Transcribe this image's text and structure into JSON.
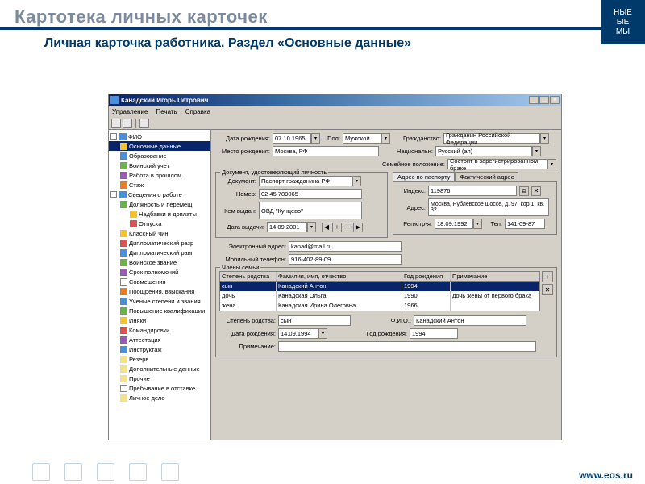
{
  "slide": {
    "title": "Картотека личных карточек",
    "subtitle": "Личная карточка работника. Раздел «Основные данные»",
    "footer_url": "www.eos.ru",
    "logo_lines": [
      "НЫЕ",
      "ЫЕ",
      "МЫ"
    ]
  },
  "window": {
    "title": "Канадский Игорь Петрович",
    "menus": [
      "Управление",
      "Печать",
      "Справка"
    ],
    "close": "✕",
    "min": "_",
    "max": "□"
  },
  "tree": [
    {
      "t": "ФИО",
      "lv": 0,
      "exp": "−",
      "ic": "ic-b"
    },
    {
      "t": "Основные данные",
      "lv": 1,
      "sel": true,
      "ic": "ic-y"
    },
    {
      "t": "Образование",
      "lv": 1,
      "ic": "ic-b"
    },
    {
      "t": "Воинский учет",
      "lv": 1,
      "ic": "ic-g"
    },
    {
      "t": "Работа в прошлом",
      "lv": 1,
      "ic": "ic-p"
    },
    {
      "t": "Стаж",
      "lv": 1,
      "ic": "ic-o"
    },
    {
      "t": "Сведения о работе",
      "lv": 0,
      "exp": "−",
      "ic": "ic-b"
    },
    {
      "t": "Должность и перемещ",
      "lv": 1,
      "ic": "ic-g"
    },
    {
      "t": "Надбавки и доплаты",
      "lv": 2,
      "ic": "ic-y"
    },
    {
      "t": "Отпуска",
      "lv": 2,
      "ic": "ic-r"
    },
    {
      "t": "Классный чин",
      "lv": 1,
      "ic": "ic-y"
    },
    {
      "t": "Дипломатический разр",
      "lv": 1,
      "ic": "ic-r"
    },
    {
      "t": "Дипломатический ранг",
      "lv": 1,
      "ic": "ic-b"
    },
    {
      "t": "Воинское звание",
      "lv": 1,
      "ic": "ic-g"
    },
    {
      "t": "Срок полномочий",
      "lv": 1,
      "ic": "ic-p"
    },
    {
      "t": "Совмещения",
      "lv": 1,
      "ic": "ic-w"
    },
    {
      "t": "Поощрения, взыскания",
      "lv": 1,
      "ic": "ic-o"
    },
    {
      "t": "Ученые степени и звания",
      "lv": 1,
      "ic": "ic-b"
    },
    {
      "t": "Повышение квалификации",
      "lv": 1,
      "ic": "ic-g"
    },
    {
      "t": "Иняки",
      "lv": 1,
      "ic": "ic-y"
    },
    {
      "t": "Командировки",
      "lv": 1,
      "ic": "ic-r"
    },
    {
      "t": "Аттестация",
      "lv": 1,
      "ic": "ic-p"
    },
    {
      "t": "Инструктаж",
      "lv": 1,
      "ic": "ic-b"
    },
    {
      "t": "Резерв",
      "lv": 1,
      "ic": "ic-folder"
    },
    {
      "t": "Дополнительные данные",
      "lv": 1,
      "ic": "ic-folder"
    },
    {
      "t": "Прочие",
      "lv": 1,
      "ic": "ic-folder"
    },
    {
      "t": "Пребывание в отставке",
      "lv": 1,
      "ic": "ic-w"
    },
    {
      "t": "Личное дело",
      "lv": 1,
      "ic": "ic-folder"
    }
  ],
  "form": {
    "birth_label": "Дата рождения:",
    "birth_value": "07.10.1965",
    "sex_label": "Пол:",
    "sex_value": "Мужской",
    "citizenship_label": "Гражданство:",
    "citizenship_value": "Гражданин Российской Федерации",
    "birthplace_label": "Место рождения:",
    "birthplace_value": "Москва, РФ",
    "nationality_label": "Национальн:",
    "nationality_value": "Русский (ая)",
    "marital_label": "Семейное положение:",
    "marital_value": "Состоит в зарегистрированном браке",
    "doc_group": "Документ, удостоверяющий личность",
    "addr_group_tabs": [
      "Адрес по паспорту",
      "Фактический адрес"
    ],
    "doc_label": "Документ:",
    "doc_value": "Паспорт гражданина РФ",
    "number_label": "Номер:",
    "number_value": "02 45 789065",
    "issuer_label": "Кем выдан:",
    "issuer_value": "ОВД \"Кунцево\"",
    "issue_date_label": "Дата выдачи:",
    "issue_date_value": "14.09.2001",
    "index_label": "Индекс:",
    "index_value": "119876",
    "address_label": "Адрес:",
    "address_value": "Москва, Рублевское шоссе, д. 97, кор 1, кв. 32",
    "reg_label": "Регистр-я:",
    "reg_value": "18.09.1992",
    "tel_label": "Тел:",
    "tel_value": "141-09-87",
    "email_label": "Электронный адрес:",
    "email_value": "kanad@mail.ru",
    "mobile_label": "Мобильный телефон:",
    "mobile_value": "916-402-89-09",
    "family_group": "Члены семьи",
    "fam_headers": [
      "Степень родства",
      "Фамилия, имя, отчество",
      "Год рождения",
      "Примечание"
    ],
    "fam_rows": [
      {
        "rel": "сын",
        "name": "Канадский Антон",
        "year": "1994",
        "note": ""
      },
      {
        "rel": "дочь",
        "name": "Канадская Ольга",
        "year": "1990",
        "note": "дочь жены от первого брака"
      },
      {
        "rel": "жена",
        "name": "Канадская Ирина Олеговна",
        "year": "1966",
        "note": ""
      }
    ],
    "det_rel_label": "Степень родства:",
    "det_rel_value": "сын",
    "det_fio_label": "Ф.И.О.:",
    "det_fio_value": "Канадский Антон",
    "det_birth_label": "Дата рождения:",
    "det_birth_value": "14.09.1994",
    "det_year_label": "Год рождения:",
    "det_year_value": "1994",
    "det_note_label": "Примечание:",
    "det_note_value": ""
  }
}
